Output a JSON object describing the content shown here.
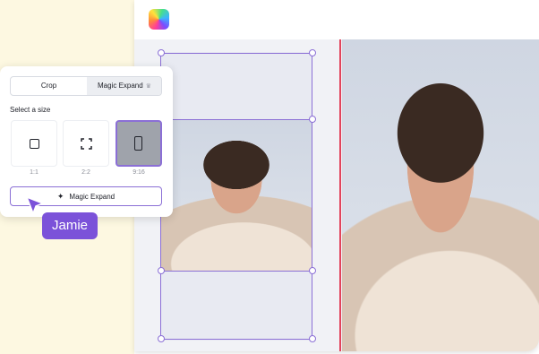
{
  "app": {
    "logo_icon": "canva-logo-icon",
    "accent": "#8b6fd6"
  },
  "panel": {
    "tabs": [
      {
        "label": "Crop",
        "active": false
      },
      {
        "label": "Magic Expand",
        "active": true,
        "badge_icon": "crown-icon"
      }
    ],
    "size_section_label": "Select a size",
    "sizes": [
      {
        "label": "1:1",
        "icon": "square-icon",
        "selected": false
      },
      {
        "label": "2:2",
        "icon": "corner-brackets-icon",
        "selected": false
      },
      {
        "label": "9:16",
        "icon": "portrait-icon",
        "selected": true
      }
    ],
    "action_button": {
      "label": "Magic Expand",
      "icon": "sparkle-icon"
    }
  },
  "collaborator": {
    "name": "Jamie",
    "color": "#7b52d9"
  },
  "canvas": {
    "divider_color": "#e2445c"
  }
}
